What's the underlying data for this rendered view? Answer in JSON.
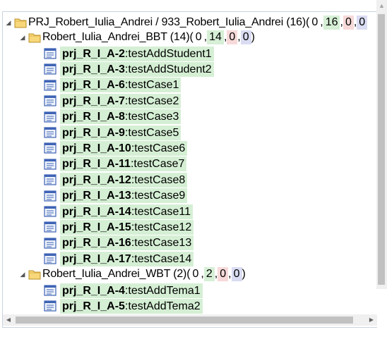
{
  "tree": {
    "root": {
      "label": "PRJ_Robert_Iulia_Andrei / 933_Robert_Iulia_Andrei (16)",
      "counts": [
        "0",
        "16",
        "0",
        "0"
      ]
    },
    "suites": [
      {
        "label": "Robert_Iulia_Andrei_BBT (14)",
        "counts": [
          "0",
          "14",
          "0",
          "0"
        ],
        "cases": [
          {
            "id": "prj_R_I_A-2",
            "name": ":testAddStudent1"
          },
          {
            "id": "prj_R_I_A-3",
            "name": ":testAddStudent2"
          },
          {
            "id": "prj_R_I_A-6",
            "name": ":testCase1"
          },
          {
            "id": "prj_R_I_A-7",
            "name": ":testCase2"
          },
          {
            "id": "prj_R_I_A-8",
            "name": ":testCase3"
          },
          {
            "id": "prj_R_I_A-9",
            "name": ":testCase5"
          },
          {
            "id": "prj_R_I_A-10",
            "name": ":testCase6"
          },
          {
            "id": "prj_R_I_A-11",
            "name": ":testCase7"
          },
          {
            "id": "prj_R_I_A-12",
            "name": ":testCase8"
          },
          {
            "id": "prj_R_I_A-13",
            "name": ":testCase9"
          },
          {
            "id": "prj_R_I_A-14",
            "name": ":testCase11"
          },
          {
            "id": "prj_R_I_A-15",
            "name": ":testCase12"
          },
          {
            "id": "prj_R_I_A-16",
            "name": ":testCase13"
          },
          {
            "id": "prj_R_I_A-17",
            "name": ":testCase14"
          }
        ]
      },
      {
        "label": "Robert_Iulia_Andrei_WBT (2)",
        "counts": [
          "0",
          "2",
          "0",
          "0"
        ],
        "cases": [
          {
            "id": "prj_R_I_A-4",
            "name": ":testAddTema1"
          },
          {
            "id": "prj_R_I_A-5",
            "name": ":testAddTema2"
          }
        ]
      }
    ]
  },
  "colors": {
    "passed_bg": "#d5efd4",
    "failed_bg": "#f7d9d9",
    "blocked_bg": "#d9dcf2"
  },
  "icons": {
    "expander": "triangle-down-icon",
    "folder": "folder-icon",
    "test_case": "test-case-icon"
  }
}
